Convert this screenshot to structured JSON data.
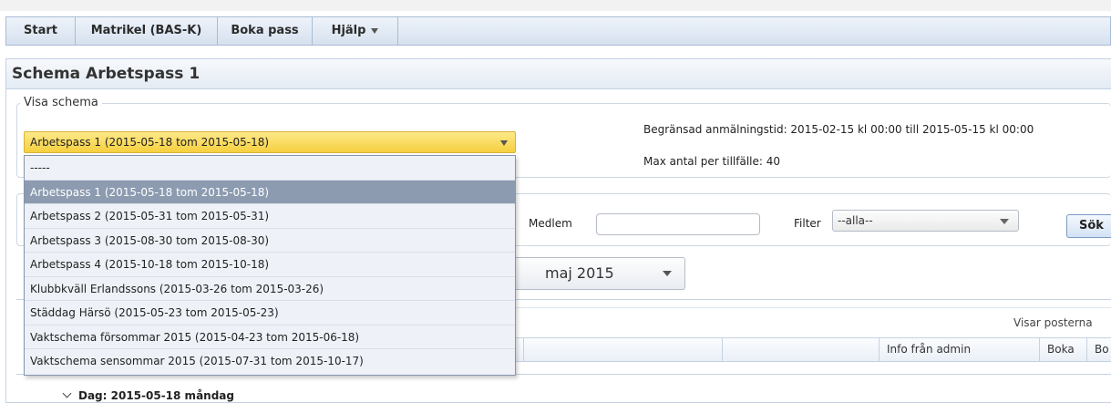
{
  "menu": [
    {
      "label": "Start"
    },
    {
      "label": "Matrikel (BAS-K)"
    },
    {
      "label": "Boka pass"
    },
    {
      "label": "Hjälp"
    }
  ],
  "page_title": "Schema Arbetspass 1",
  "visa_schema": {
    "legend": "Visa schema",
    "selected": "Arbetspass 1 (2015-05-18 tom 2015-05-18)",
    "options": [
      "-----",
      "Arbetspass 1 (2015-05-18 tom 2015-05-18)",
      "Arbetspass 2 (2015-05-31 tom 2015-05-31)",
      "Arbetspass 3 (2015-08-30 tom 2015-08-30)",
      "Arbetspass 4 (2015-10-18 tom 2015-10-18)",
      "Klubbkväll Erlandssons (2015-03-26 tom 2015-03-26)",
      "Städdag Härsö (2015-05-23 tom 2015-05-23)",
      "Vaktschema försommar 2015 (2015-04-23 tom 2015-06-18)",
      "Vaktschema sensommar 2015 (2015-07-31 tom 2015-10-17)"
    ],
    "anmalningstid": "Begränsad anmälningstid: 2015-02-15 kl 00:00 till 2015-05-15 kl 00:00",
    "max_antal": "Max antal per tillfälle: 40"
  },
  "search": {
    "medlem_label": "Medlem",
    "medlem_value": "",
    "filter_label": "Filter",
    "filter_value": "--alla--",
    "sok_label": "Sök"
  },
  "month": "maj 2015",
  "grid": {
    "visar": "Visar posterna",
    "columns": [
      "",
      "",
      "Info från admin",
      "Boka",
      "Bo"
    ]
  },
  "day_row": "Dag: 2015-05-18 måndag"
}
